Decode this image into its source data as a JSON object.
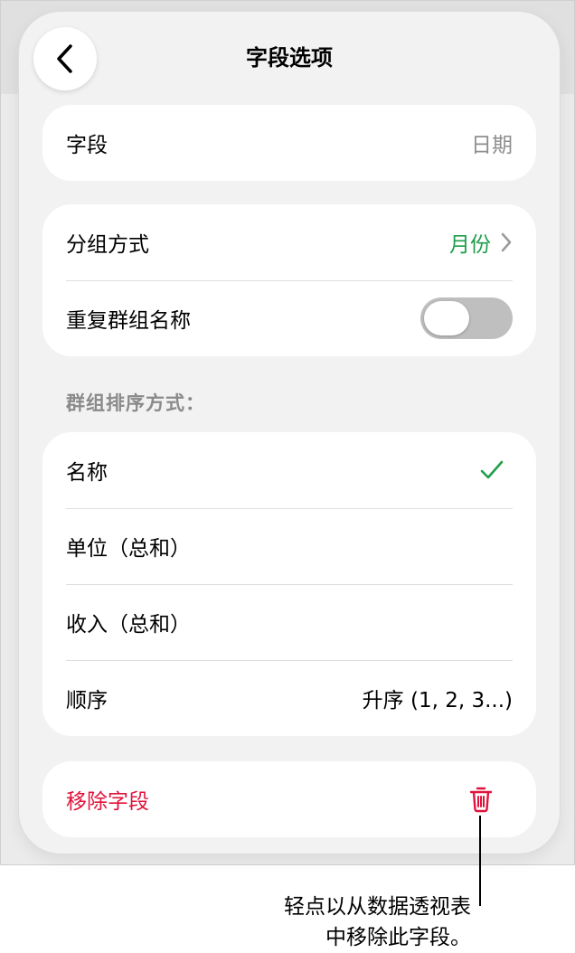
{
  "header": {
    "title": "字段选项",
    "back_icon": "chevron-left-icon"
  },
  "field_card": {
    "label": "字段",
    "value": "日期"
  },
  "grouping_card": {
    "group_by_label": "分组方式",
    "group_by_value": "月份",
    "repeat_names_label": "重复群组名称",
    "repeat_names_on": false
  },
  "sort_section": {
    "header": "群组排序方式：",
    "options": [
      {
        "label": "名称",
        "selected": true
      },
      {
        "label": "单位（总和）",
        "selected": false
      },
      {
        "label": "收入（总和）",
        "selected": false
      }
    ],
    "order_label": "顺序",
    "order_value": "升序 (1, 2, 3...)"
  },
  "remove_card": {
    "label": "移除字段",
    "icon": "trash-icon"
  },
  "callout": {
    "line1": "轻点以从数据透视表",
    "line2": "中移除此字段。"
  },
  "colors": {
    "accent": "#1e9e4a",
    "danger": "#e0143c",
    "toggle_off": "#bfbfbf"
  }
}
